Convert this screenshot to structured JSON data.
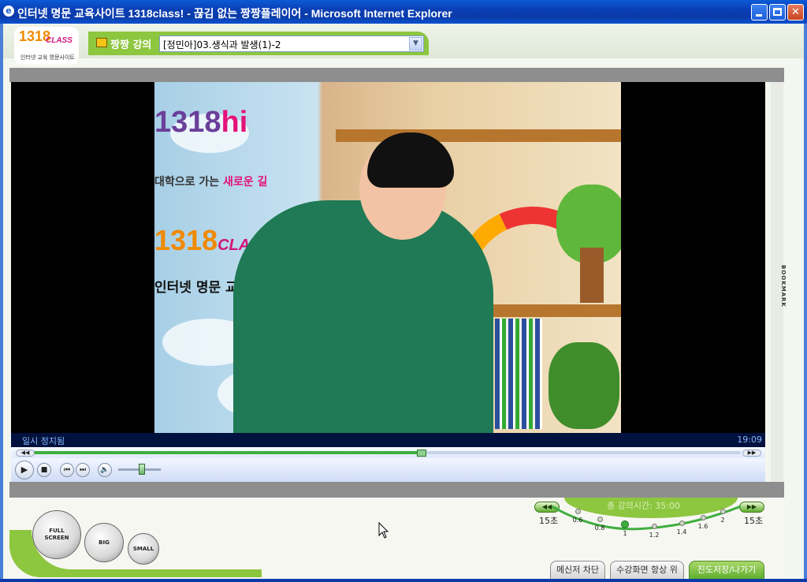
{
  "window": {
    "title": "인터넷 명문 교육사이트 1318class! - 끊김 없는 짱짱플레이어 - Microsoft Internet Explorer",
    "minimize_icon": "minimize-icon",
    "maximize_icon": "maximize-icon",
    "close_icon": "close-icon"
  },
  "header": {
    "logo_number": "1318",
    "logo_class": "CLASS",
    "logo_tagline": "인터넷 교육 명문사이트",
    "lecture_label": "짱짱 강의",
    "lecture_select_value": "[정민아]03.생식과 발생(1)-2"
  },
  "video": {
    "sign_logo_a": "1318",
    "sign_logo_b": "hi",
    "sign_text_a": "대학으로 가는 ",
    "sign_text_highlight": "새로운 길",
    "sign_logo2_num": "1318",
    "sign_logo2_class": "CLASS",
    "sign_text_2": "인터넷 명문 교육사이트"
  },
  "player": {
    "status_text": "일시 정지됨",
    "time_text": "19:09",
    "seek_progress": 0.555,
    "volume_level": 0.55,
    "bookmark_label": "BOOKMARK"
  },
  "size_buttons": {
    "full": "FULL SCREEN",
    "big": "BIG",
    "small": "SMALL"
  },
  "speed": {
    "title": "총 강의시간: 35:00",
    "back_label": "15초",
    "forward_label": "15초",
    "steps": [
      "0.6",
      "0.8",
      "1",
      "1.2",
      "1.4",
      "1.6",
      "2"
    ],
    "current_step": "1"
  },
  "tabs": {
    "messenger_block": "메신저 차단",
    "always_on_top": "수강화면 항상 위",
    "save_exit": "진도저장/나가기"
  }
}
